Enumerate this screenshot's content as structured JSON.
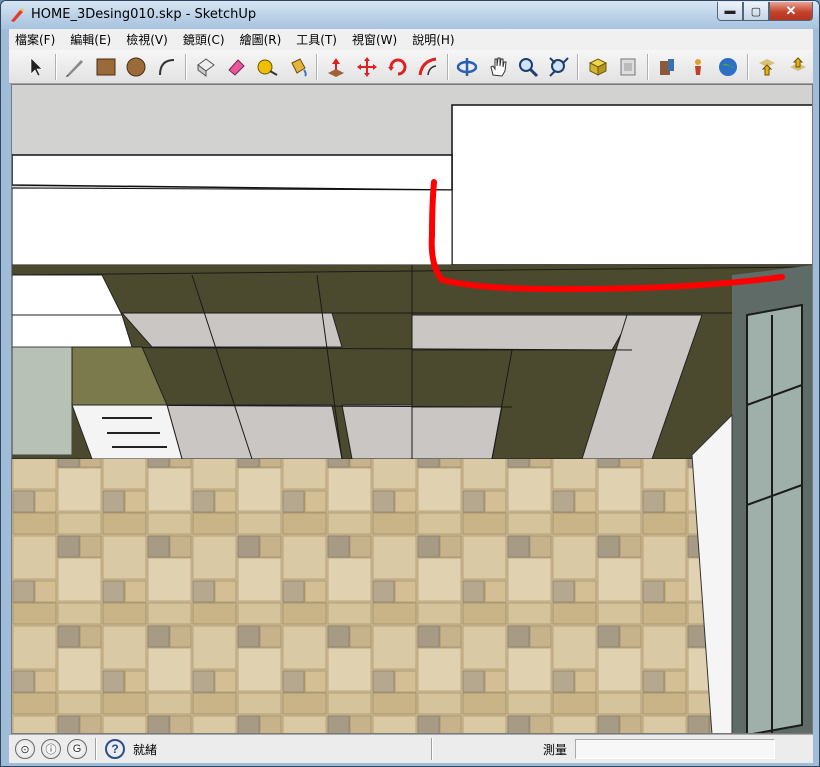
{
  "window": {
    "title": "HOME_3Desing010.skp - SketchUp",
    "minimize_label": "▬",
    "maximize_label": "▢",
    "close_label": "✕"
  },
  "menu": {
    "items": [
      {
        "label": "檔案(F)"
      },
      {
        "label": "編輯(E)"
      },
      {
        "label": "檢視(V)"
      },
      {
        "label": "鏡頭(C)"
      },
      {
        "label": "繪圖(R)"
      },
      {
        "label": "工具(T)"
      },
      {
        "label": "視窗(W)"
      },
      {
        "label": "說明(H)"
      }
    ]
  },
  "toolbar": {
    "tools": [
      "select-tool-icon",
      "pencil-line-icon",
      "rectangle-icon",
      "circle-icon",
      "arc-icon",
      "eraser-icon",
      "paint-eraser-icon",
      "tape-measure-icon",
      "paint-bucket-icon",
      "push-pull-icon",
      "move-icon",
      "rotate-icon",
      "follow-me-icon",
      "orbit-icon",
      "pan-icon",
      "zoom-icon",
      "zoom-extents-icon",
      "get-models-icon",
      "share-model-icon",
      "components-icon",
      "position-camera-icon",
      "google-earth-icon",
      "import-icon",
      "export-icon"
    ]
  },
  "status": {
    "text": "就緒",
    "measure_label": "測量",
    "measure_value": ""
  },
  "colors": {
    "annotation_stroke": "#ff0000",
    "tile_dark": "#4b4a2e",
    "tile_light": "#c9c6c4",
    "wall_white": "#ffffff"
  }
}
